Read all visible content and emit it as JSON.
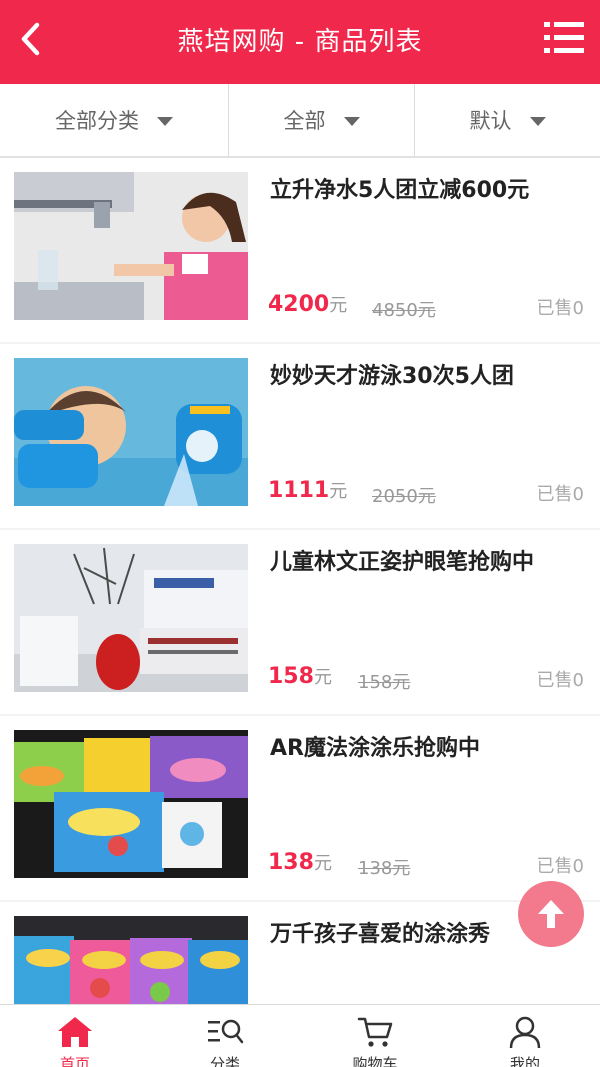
{
  "header": {
    "title": "燕培网购 - 商品列表"
  },
  "filters": [
    {
      "label": "全部分类"
    },
    {
      "label": "全部"
    },
    {
      "label": "默认"
    }
  ],
  "products": [
    {
      "name": "立升净水5人团立减600元",
      "price": "4200",
      "unit": "元",
      "original_price": "4850元",
      "sold": "已售0"
    },
    {
      "name": "妙妙天才游泳30次5人团",
      "price": "1111",
      "unit": "元",
      "original_price": "2050元",
      "sold": "已售0"
    },
    {
      "name": "儿童林文正姿护眼笔抢购中",
      "price": "158",
      "unit": "元",
      "original_price": "158元",
      "sold": "已售0"
    },
    {
      "name": "AR魔法涂涂乐抢购中",
      "price": "138",
      "unit": "元",
      "original_price": "138元",
      "sold": "已售0"
    },
    {
      "name": "万千孩子喜爱的涂涂秀",
      "price": "",
      "unit": "",
      "original_price": "",
      "sold": ""
    }
  ],
  "tabbar": [
    {
      "label": "首页",
      "icon": "home-icon",
      "active": true
    },
    {
      "label": "分类",
      "icon": "category-search-icon",
      "active": false
    },
    {
      "label": "购物车",
      "icon": "cart-icon",
      "active": false
    },
    {
      "label": "我的",
      "icon": "user-icon",
      "active": false
    }
  ],
  "colors": {
    "brand": "#f0294c",
    "back_to_top": "#f37a8d",
    "muted": "#999999"
  }
}
